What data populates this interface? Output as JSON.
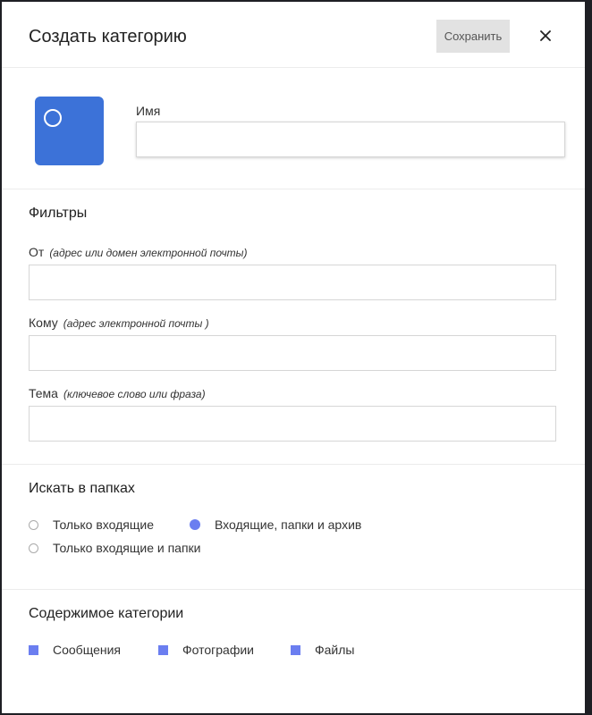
{
  "header": {
    "title": "Создать категорию",
    "save_label": "Сохранить",
    "close_icon": "×"
  },
  "name_section": {
    "label": "Имя",
    "value": "",
    "avatar_color": "#3c72d8"
  },
  "filters": {
    "heading": "Фильтры",
    "from": {
      "label": "От",
      "hint": "(адрес или домен электронной почты)",
      "value": ""
    },
    "to": {
      "label": "Кому",
      "hint": "(адрес электронной почты )",
      "value": ""
    },
    "subject": {
      "label": "Тема",
      "hint": "(ключевое слово или фраза)",
      "value": ""
    }
  },
  "folders": {
    "heading": "Искать в папках",
    "options": [
      {
        "label": "Только входящие",
        "selected": false
      },
      {
        "label": "Входящие, папки и архив",
        "selected": true
      },
      {
        "label": "Только входящие и папки",
        "selected": false
      }
    ]
  },
  "content": {
    "heading": "Содержимое категории",
    "items": [
      {
        "label": "Сообщения",
        "checked": true
      },
      {
        "label": "Фотографии",
        "checked": true
      },
      {
        "label": "Файлы",
        "checked": true
      }
    ]
  },
  "colors": {
    "accent": "#6b7ef0",
    "avatar": "#3c72d8"
  }
}
